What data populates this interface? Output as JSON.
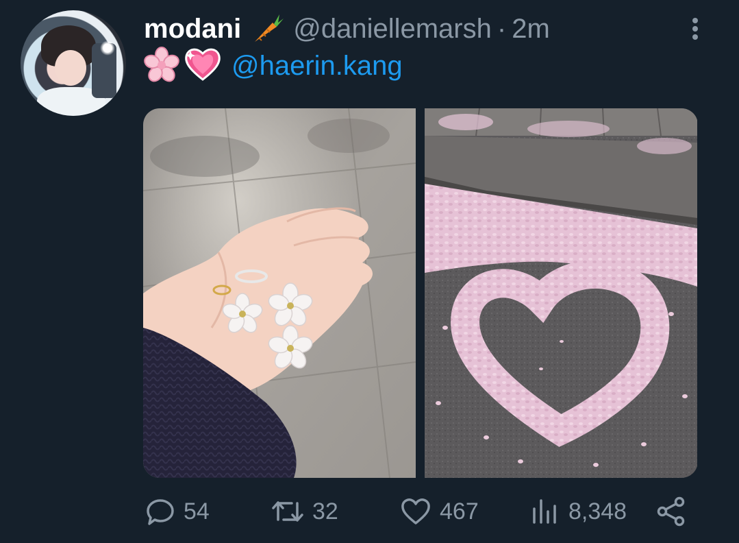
{
  "user": {
    "display_name": "modani",
    "name_emoji_icon": "carrot-icon",
    "handle": "@daniellemarsh",
    "separator": "·",
    "timestamp": "2m"
  },
  "tweet": {
    "emoji_icons": [
      "cherry-blossom-icon",
      "sparkling-heart-icon"
    ],
    "mention": "@haerin.kang"
  },
  "media": [
    {
      "name": "hand-holding-cherry-blossoms-photo"
    },
    {
      "name": "petal-heart-on-pavement-photo"
    }
  ],
  "metrics": {
    "replies": "54",
    "retweets": "32",
    "likes": "467",
    "views": "8,348"
  },
  "colors": {
    "background": "#15202b",
    "secondary_text": "#8b98a5",
    "link": "#1d9bf0"
  }
}
